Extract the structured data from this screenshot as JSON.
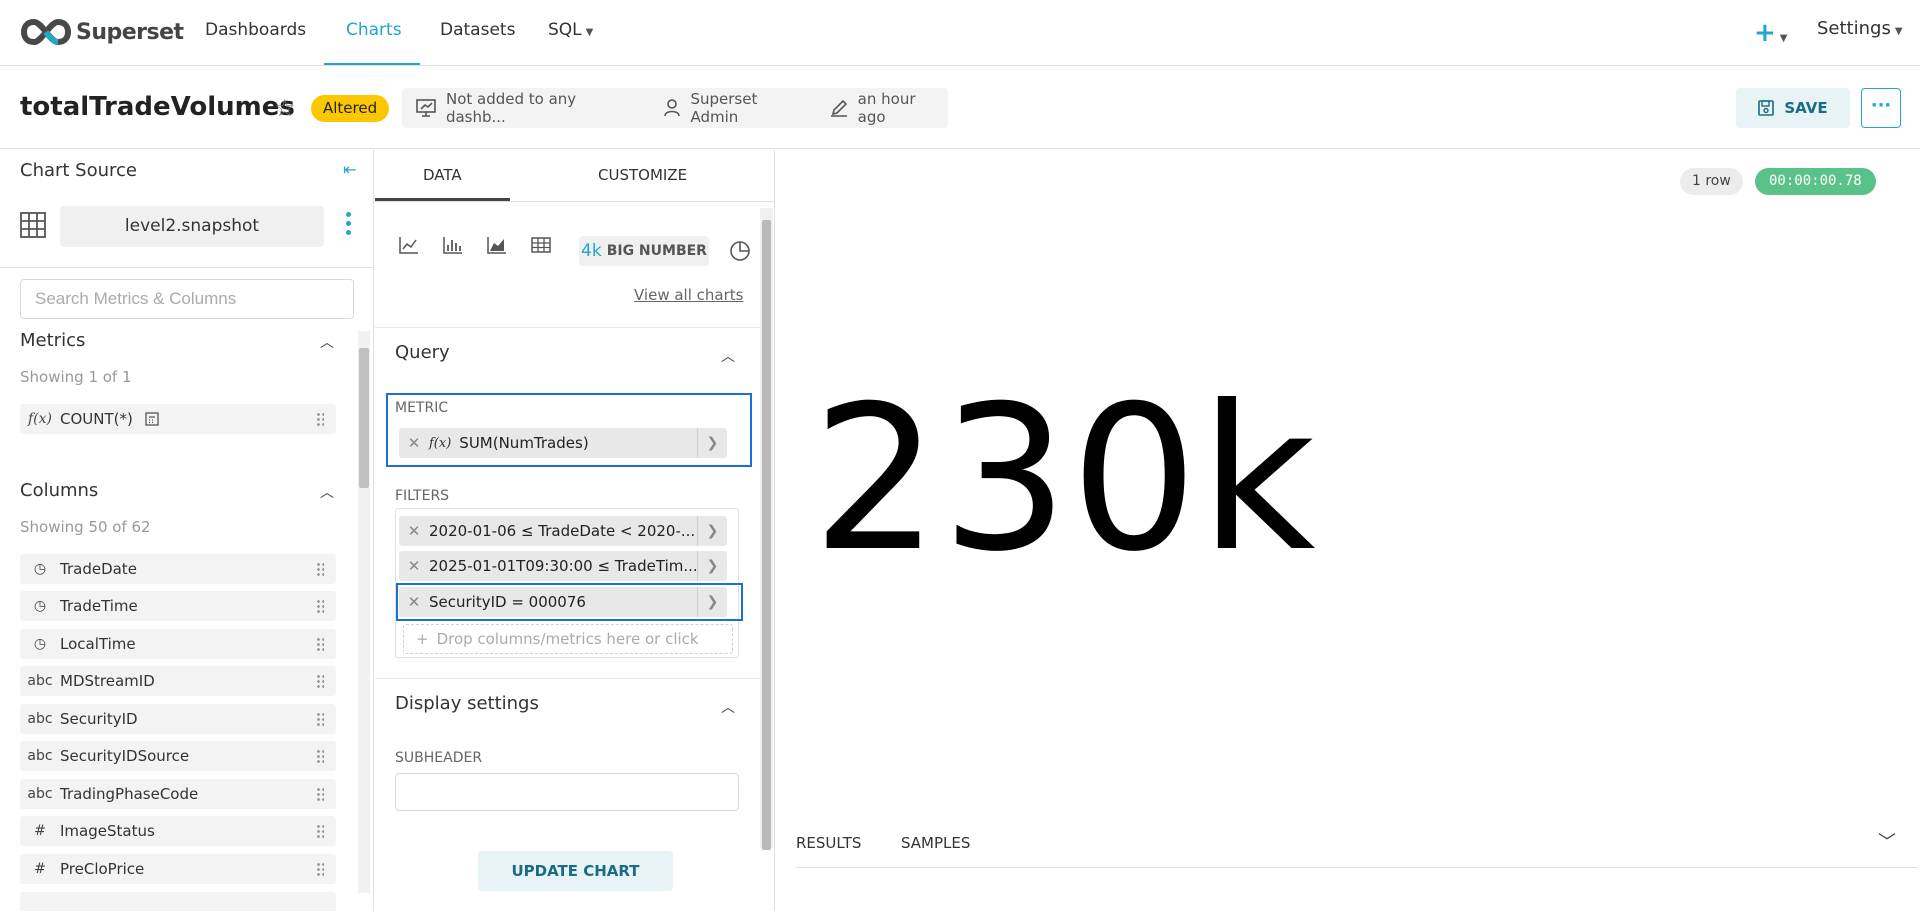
{
  "nav": {
    "logo_text": "Superset",
    "items": [
      {
        "label": "Dashboards"
      },
      {
        "label": "Charts"
      },
      {
        "label": "Datasets"
      },
      {
        "label": "SQL"
      }
    ],
    "plus_label": "+",
    "settings_label": "Settings",
    "accent_color": "#20a7c9"
  },
  "header": {
    "title": "totalTradeVolumes",
    "altered_badge": "Altered",
    "dashboards_text": "Not added to any dashb...",
    "owner_text": "Superset Admin",
    "modified_text": "an hour ago",
    "save_label": "SAVE",
    "more_label": "···"
  },
  "left": {
    "source_label": "Chart Source",
    "dataset_name": "level2.snapshot",
    "search_placeholder": "Search Metrics & Columns",
    "metrics_title": "Metrics",
    "metrics_showing": "Showing 1 of 1",
    "metrics": [
      {
        "type": "f(x)",
        "name": "COUNT(*)"
      }
    ],
    "columns_title": "Columns",
    "columns_showing": "Showing 50 of 62",
    "columns": [
      {
        "type": "clock",
        "name": "TradeDate"
      },
      {
        "type": "clock",
        "name": "TradeTime"
      },
      {
        "type": "clock",
        "name": "LocalTime"
      },
      {
        "type": "abc",
        "name": "MDStreamID"
      },
      {
        "type": "abc",
        "name": "SecurityID"
      },
      {
        "type": "abc",
        "name": "SecurityIDSource"
      },
      {
        "type": "abc",
        "name": "TradingPhaseCode"
      },
      {
        "type": "#",
        "name": "ImageStatus"
      },
      {
        "type": "#",
        "name": "PreCloPrice"
      }
    ]
  },
  "control": {
    "tab_data": "DATA",
    "tab_customize": "CUSTOMIZE",
    "bignum_prefix": "4k",
    "bignum_label": "BIG NUMBER",
    "view_all": "View all charts",
    "query_title": "Query",
    "metric_label": "METRIC",
    "metric_value": "SUM(NumTrades)",
    "filters_label": "FILTERS",
    "filters": [
      "2020-01-06 ≤ TradeDate < 2020-...",
      "2025-01-01T09:30:00 ≤ TradeTim...",
      "SecurityID = 000076"
    ],
    "drop_placeholder": "Drop columns/metrics here or click",
    "display_title": "Display settings",
    "subheader_label": "SUBHEADER",
    "subheader_value": "",
    "update_label": "UPDATE CHART"
  },
  "chart": {
    "row_count": "1 row",
    "query_time": "00:00:00.78",
    "big_number": "230k",
    "results_tab": "RESULTS",
    "samples_tab": "SAMPLES"
  }
}
